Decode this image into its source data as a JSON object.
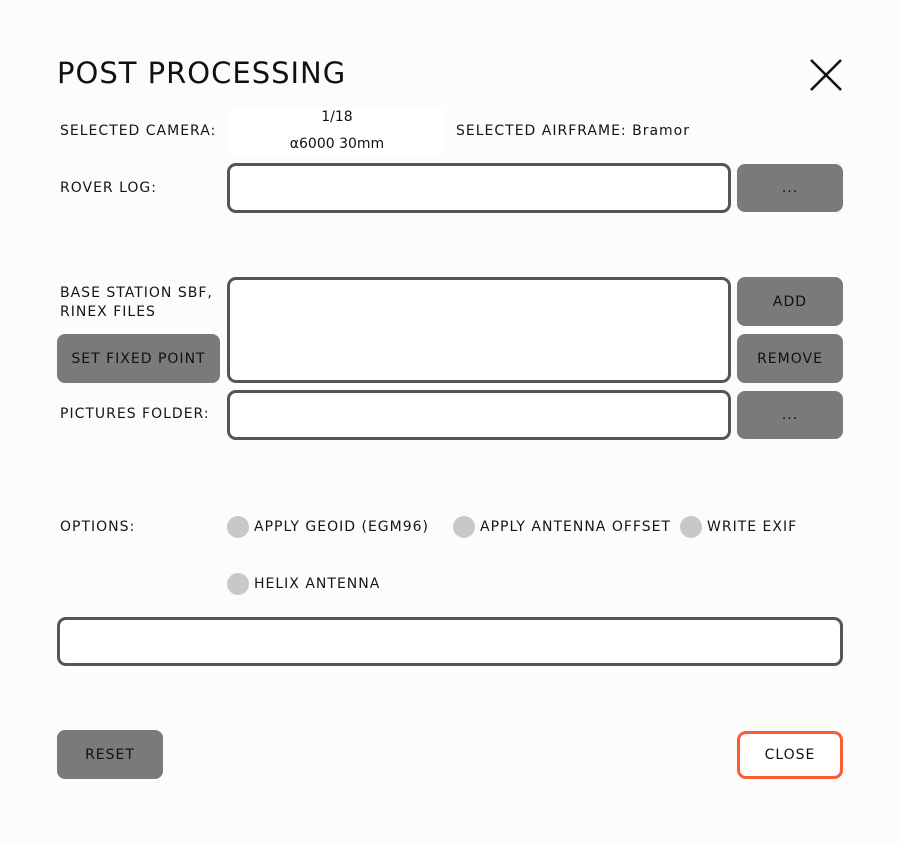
{
  "dialog": {
    "title": "POST PROCESSING",
    "close_icon": "close-x-icon"
  },
  "camera": {
    "label": "SELECTED CAMERA:",
    "index": "1/18",
    "name": "α6000 30mm"
  },
  "airframe": {
    "label": "SELECTED AIRFRAME: Bramor"
  },
  "rover_log": {
    "label": "ROVER LOG:",
    "value": "",
    "browse_label": "..."
  },
  "base_station": {
    "label_line1": "BASE STATION SBF,",
    "label_line2": "RINEX FILES",
    "files": [],
    "add_label": "ADD",
    "remove_label": "REMOVE",
    "set_fixed_point_label": "SET FIXED POINT"
  },
  "pictures_folder": {
    "label": "PICTURES FOLDER:",
    "value": "",
    "browse_label": "..."
  },
  "options": {
    "label": "OPTIONS:",
    "items": [
      {
        "label": "APPLY GEOID (EGM96)",
        "checked": false
      },
      {
        "label": "APPLY ANTENNA OFFSET",
        "checked": false
      },
      {
        "label": "WRITE EXIF",
        "checked": false
      },
      {
        "label": "HELIX ANTENNA",
        "checked": false
      }
    ]
  },
  "status": {
    "value": ""
  },
  "footer": {
    "reset_label": "RESET",
    "close_label": "CLOSE"
  },
  "colors": {
    "accent": "#ff5a36",
    "button": "#7a7a7a",
    "radio": "#c8c8c8",
    "field_border": "#555555"
  }
}
